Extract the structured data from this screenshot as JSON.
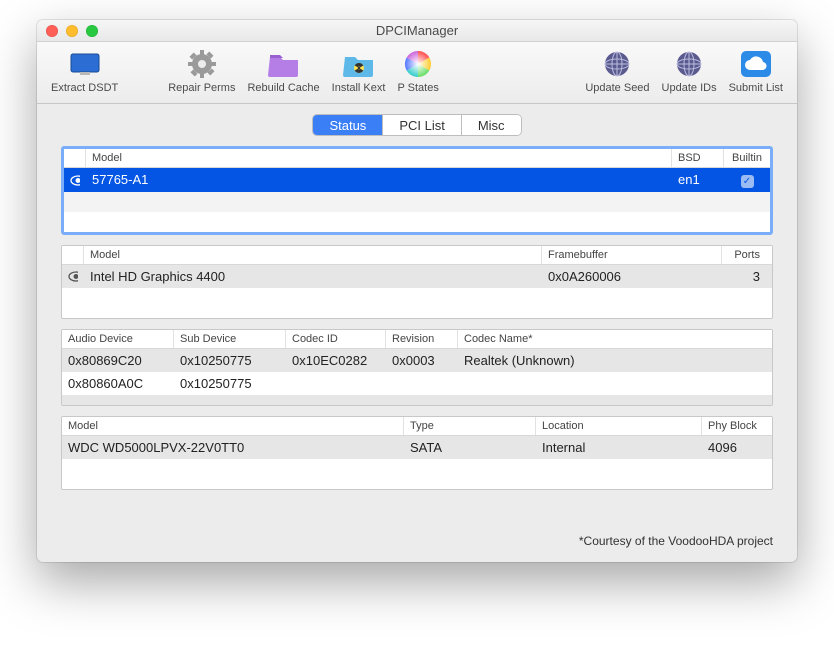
{
  "app_title": "DPCIManager",
  "toolbar": {
    "left": [
      {
        "label": "Extract DSDT",
        "icon": "monitor-icon"
      },
      {
        "label": "Repair Perms",
        "icon": "gear-icon"
      },
      {
        "label": "Rebuild Cache",
        "icon": "folder-icon"
      },
      {
        "label": "Install Kext",
        "icon": "radiation-icon"
      },
      {
        "label": "P States",
        "icon": "color-wheel-icon"
      }
    ],
    "right": [
      {
        "label": "Update Seed",
        "icon": "globe-icon"
      },
      {
        "label": "Update IDs",
        "icon": "globe-icon"
      },
      {
        "label": "Submit List",
        "icon": "cloud-icon"
      }
    ]
  },
  "tabs": {
    "status": "Status",
    "pcilist": "PCI List",
    "misc": "Misc",
    "active": "status"
  },
  "network": {
    "headers": {
      "model": "Model",
      "bsd": "BSD",
      "builtin": "Builtin"
    },
    "rows": [
      {
        "model": "57765-A1",
        "bsd": "en1",
        "builtin": true,
        "selected": true
      }
    ]
  },
  "graphics": {
    "headers": {
      "model": "Model",
      "framebuffer": "Framebuffer",
      "ports": "Ports"
    },
    "rows": [
      {
        "model": "Intel HD Graphics 4400",
        "framebuffer": "0x0A260006",
        "ports": "3"
      }
    ]
  },
  "audio": {
    "headers": {
      "audio_device": "Audio Device",
      "sub_device": "Sub Device",
      "codec_id": "Codec ID",
      "revision": "Revision",
      "codec_name": "Codec Name*"
    },
    "rows": [
      {
        "audio_device": "0x80869C20",
        "sub_device": "0x10250775",
        "codec_id": "0x10EC0282",
        "revision": "0x0003",
        "codec_name": "Realtek (Unknown)"
      },
      {
        "audio_device": "0x80860A0C",
        "sub_device": "0x10250775",
        "codec_id": "",
        "revision": "",
        "codec_name": ""
      }
    ]
  },
  "storage": {
    "headers": {
      "model": "Model",
      "type": "Type",
      "location": "Location",
      "phy_block": "Phy Block"
    },
    "rows": [
      {
        "model": "WDC WD5000LPVX-22V0TT0",
        "type": "SATA",
        "location": "Internal",
        "phy_block": "4096"
      }
    ]
  },
  "footer": "*Courtesy of the VoodooHDA project"
}
